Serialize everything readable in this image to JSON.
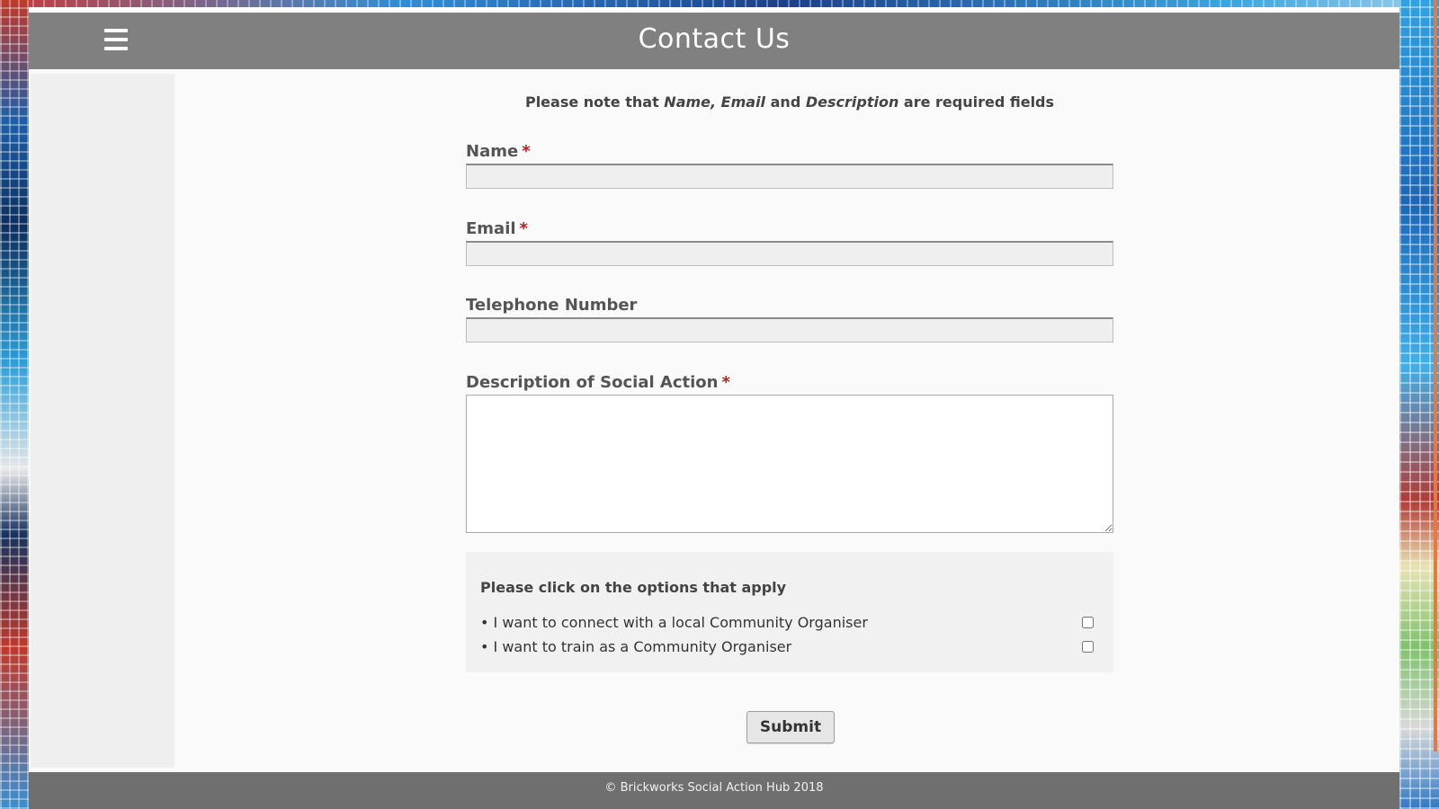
{
  "header": {
    "title": "Contact Us",
    "menu_icon": "hamburger-menu-icon"
  },
  "form": {
    "note_prefix": "Please note that",
    "note_name": "Name",
    "note_sep": ",",
    "note_email": "Email",
    "note_and": "and",
    "note_description": "Description",
    "note_suffix": "are required fields",
    "required_marker": "*",
    "fields": {
      "name": {
        "label": "Name",
        "value": "",
        "required": true
      },
      "email": {
        "label": "Email",
        "value": "",
        "required": true
      },
      "telephone": {
        "label": "Telephone Number",
        "value": "",
        "required": false
      },
      "description": {
        "label": "Description of Social Action",
        "value": "",
        "required": true
      }
    },
    "options": {
      "title": "Please click on the options that apply",
      "items": [
        {
          "label": "• I want to connect with a local Community Organiser",
          "checked": false
        },
        {
          "label": "• I want to train as a Community Organiser",
          "checked": false
        }
      ]
    },
    "submit_label": "Submit"
  },
  "footer": {
    "text": "© Brickworks Social Action Hub 2018"
  },
  "colors": {
    "header_bg": "#808080",
    "footer_bg": "#6f6f6f",
    "required": "#b22222",
    "page_bg": "#fafafa"
  }
}
